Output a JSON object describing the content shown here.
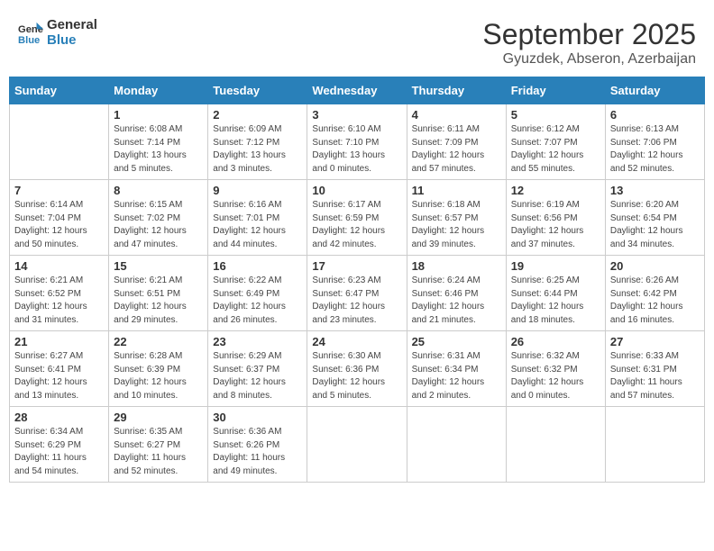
{
  "header": {
    "logo_line1": "General",
    "logo_line2": "Blue",
    "title": "September 2025",
    "subtitle": "Gyuzdek, Abseron, Azerbaijan"
  },
  "days_of_week": [
    "Sunday",
    "Monday",
    "Tuesday",
    "Wednesday",
    "Thursday",
    "Friday",
    "Saturday"
  ],
  "weeks": [
    [
      {
        "day": "",
        "sunrise": "",
        "sunset": "",
        "daylight": ""
      },
      {
        "day": "1",
        "sunrise": "Sunrise: 6:08 AM",
        "sunset": "Sunset: 7:14 PM",
        "daylight": "Daylight: 13 hours and 5 minutes."
      },
      {
        "day": "2",
        "sunrise": "Sunrise: 6:09 AM",
        "sunset": "Sunset: 7:12 PM",
        "daylight": "Daylight: 13 hours and 3 minutes."
      },
      {
        "day": "3",
        "sunrise": "Sunrise: 6:10 AM",
        "sunset": "Sunset: 7:10 PM",
        "daylight": "Daylight: 13 hours and 0 minutes."
      },
      {
        "day": "4",
        "sunrise": "Sunrise: 6:11 AM",
        "sunset": "Sunset: 7:09 PM",
        "daylight": "Daylight: 12 hours and 57 minutes."
      },
      {
        "day": "5",
        "sunrise": "Sunrise: 6:12 AM",
        "sunset": "Sunset: 7:07 PM",
        "daylight": "Daylight: 12 hours and 55 minutes."
      },
      {
        "day": "6",
        "sunrise": "Sunrise: 6:13 AM",
        "sunset": "Sunset: 7:06 PM",
        "daylight": "Daylight: 12 hours and 52 minutes."
      }
    ],
    [
      {
        "day": "7",
        "sunrise": "Sunrise: 6:14 AM",
        "sunset": "Sunset: 7:04 PM",
        "daylight": "Daylight: 12 hours and 50 minutes."
      },
      {
        "day": "8",
        "sunrise": "Sunrise: 6:15 AM",
        "sunset": "Sunset: 7:02 PM",
        "daylight": "Daylight: 12 hours and 47 minutes."
      },
      {
        "day": "9",
        "sunrise": "Sunrise: 6:16 AM",
        "sunset": "Sunset: 7:01 PM",
        "daylight": "Daylight: 12 hours and 44 minutes."
      },
      {
        "day": "10",
        "sunrise": "Sunrise: 6:17 AM",
        "sunset": "Sunset: 6:59 PM",
        "daylight": "Daylight: 12 hours and 42 minutes."
      },
      {
        "day": "11",
        "sunrise": "Sunrise: 6:18 AM",
        "sunset": "Sunset: 6:57 PM",
        "daylight": "Daylight: 12 hours and 39 minutes."
      },
      {
        "day": "12",
        "sunrise": "Sunrise: 6:19 AM",
        "sunset": "Sunset: 6:56 PM",
        "daylight": "Daylight: 12 hours and 37 minutes."
      },
      {
        "day": "13",
        "sunrise": "Sunrise: 6:20 AM",
        "sunset": "Sunset: 6:54 PM",
        "daylight": "Daylight: 12 hours and 34 minutes."
      }
    ],
    [
      {
        "day": "14",
        "sunrise": "Sunrise: 6:21 AM",
        "sunset": "Sunset: 6:52 PM",
        "daylight": "Daylight: 12 hours and 31 minutes."
      },
      {
        "day": "15",
        "sunrise": "Sunrise: 6:21 AM",
        "sunset": "Sunset: 6:51 PM",
        "daylight": "Daylight: 12 hours and 29 minutes."
      },
      {
        "day": "16",
        "sunrise": "Sunrise: 6:22 AM",
        "sunset": "Sunset: 6:49 PM",
        "daylight": "Daylight: 12 hours and 26 minutes."
      },
      {
        "day": "17",
        "sunrise": "Sunrise: 6:23 AM",
        "sunset": "Sunset: 6:47 PM",
        "daylight": "Daylight: 12 hours and 23 minutes."
      },
      {
        "day": "18",
        "sunrise": "Sunrise: 6:24 AM",
        "sunset": "Sunset: 6:46 PM",
        "daylight": "Daylight: 12 hours and 21 minutes."
      },
      {
        "day": "19",
        "sunrise": "Sunrise: 6:25 AM",
        "sunset": "Sunset: 6:44 PM",
        "daylight": "Daylight: 12 hours and 18 minutes."
      },
      {
        "day": "20",
        "sunrise": "Sunrise: 6:26 AM",
        "sunset": "Sunset: 6:42 PM",
        "daylight": "Daylight: 12 hours and 16 minutes."
      }
    ],
    [
      {
        "day": "21",
        "sunrise": "Sunrise: 6:27 AM",
        "sunset": "Sunset: 6:41 PM",
        "daylight": "Daylight: 12 hours and 13 minutes."
      },
      {
        "day": "22",
        "sunrise": "Sunrise: 6:28 AM",
        "sunset": "Sunset: 6:39 PM",
        "daylight": "Daylight: 12 hours and 10 minutes."
      },
      {
        "day": "23",
        "sunrise": "Sunrise: 6:29 AM",
        "sunset": "Sunset: 6:37 PM",
        "daylight": "Daylight: 12 hours and 8 minutes."
      },
      {
        "day": "24",
        "sunrise": "Sunrise: 6:30 AM",
        "sunset": "Sunset: 6:36 PM",
        "daylight": "Daylight: 12 hours and 5 minutes."
      },
      {
        "day": "25",
        "sunrise": "Sunrise: 6:31 AM",
        "sunset": "Sunset: 6:34 PM",
        "daylight": "Daylight: 12 hours and 2 minutes."
      },
      {
        "day": "26",
        "sunrise": "Sunrise: 6:32 AM",
        "sunset": "Sunset: 6:32 PM",
        "daylight": "Daylight: 12 hours and 0 minutes."
      },
      {
        "day": "27",
        "sunrise": "Sunrise: 6:33 AM",
        "sunset": "Sunset: 6:31 PM",
        "daylight": "Daylight: 11 hours and 57 minutes."
      }
    ],
    [
      {
        "day": "28",
        "sunrise": "Sunrise: 6:34 AM",
        "sunset": "Sunset: 6:29 PM",
        "daylight": "Daylight: 11 hours and 54 minutes."
      },
      {
        "day": "29",
        "sunrise": "Sunrise: 6:35 AM",
        "sunset": "Sunset: 6:27 PM",
        "daylight": "Daylight: 11 hours and 52 minutes."
      },
      {
        "day": "30",
        "sunrise": "Sunrise: 6:36 AM",
        "sunset": "Sunset: 6:26 PM",
        "daylight": "Daylight: 11 hours and 49 minutes."
      },
      {
        "day": "",
        "sunrise": "",
        "sunset": "",
        "daylight": ""
      },
      {
        "day": "",
        "sunrise": "",
        "sunset": "",
        "daylight": ""
      },
      {
        "day": "",
        "sunrise": "",
        "sunset": "",
        "daylight": ""
      },
      {
        "day": "",
        "sunrise": "",
        "sunset": "",
        "daylight": ""
      }
    ]
  ]
}
